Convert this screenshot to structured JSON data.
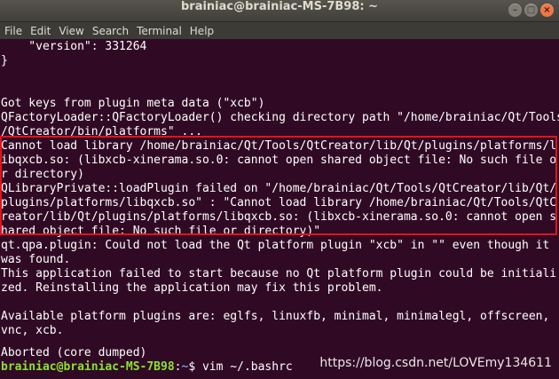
{
  "window": {
    "title": "brainiac@brainiac-MS-7B98: ~",
    "buttons": {
      "minimize": "–",
      "maximize": "□",
      "close": "×"
    }
  },
  "menubar": {
    "items": [
      "File",
      "Edit",
      "View",
      "Search",
      "Terminal",
      "Help"
    ]
  },
  "terminal": {
    "lines": [
      "    \"version\": 331264",
      "}",
      "",
      "",
      "Got keys from plugin meta data (\"xcb\")",
      "QFactoryLoader::QFactoryLoader() checking directory path \"/home/brainiac/Qt/Tools",
      "/QtCreator/bin/platforms\" ...",
      "Cannot load library /home/brainiac/Qt/Tools/QtCreator/lib/Qt/plugins/platforms/l",
      "ibqxcb.so: (libxcb-xinerama.so.0: cannot open shared object file: No such file o",
      "r directory)",
      "QLibraryPrivate::loadPlugin failed on \"/home/brainiac/Qt/Tools/QtCreator/lib/Qt/",
      "plugins/platforms/libqxcb.so\" : \"Cannot load library /home/brainiac/Qt/Tools/QtC",
      "reator/lib/Qt/plugins/platforms/libqxcb.so: (libxcb-xinerama.so.0: cannot open s",
      "hared object file: No such file or directory)\"",
      "qt.qpa.plugin: Could not load the Qt platform plugin \"xcb\" in \"\" even though it",
      "was found.",
      "This application failed to start because no Qt platform plugin could be initiali",
      "zed. Reinstalling the application may fix this problem.",
      "",
      "Available platform plugins are: eglfs, linuxfb, minimal, minimalegl, offscreen,",
      "vnc, xcb.",
      "",
      "Aborted (core dumped)"
    ],
    "prompt": {
      "user_host": "brainiac@brainiac-MS-7B98",
      "separator": ":",
      "path": "~",
      "symbol": "$ ",
      "command": "vim ~/.bashrc"
    }
  },
  "watermark": "https://blog.csdn.net/LOVEmy134611",
  "colors": {
    "terminal_bg": "#300a24",
    "prompt_user": "#8ae234",
    "prompt_path": "#729fcf",
    "highlight_border": "#e0141c"
  }
}
